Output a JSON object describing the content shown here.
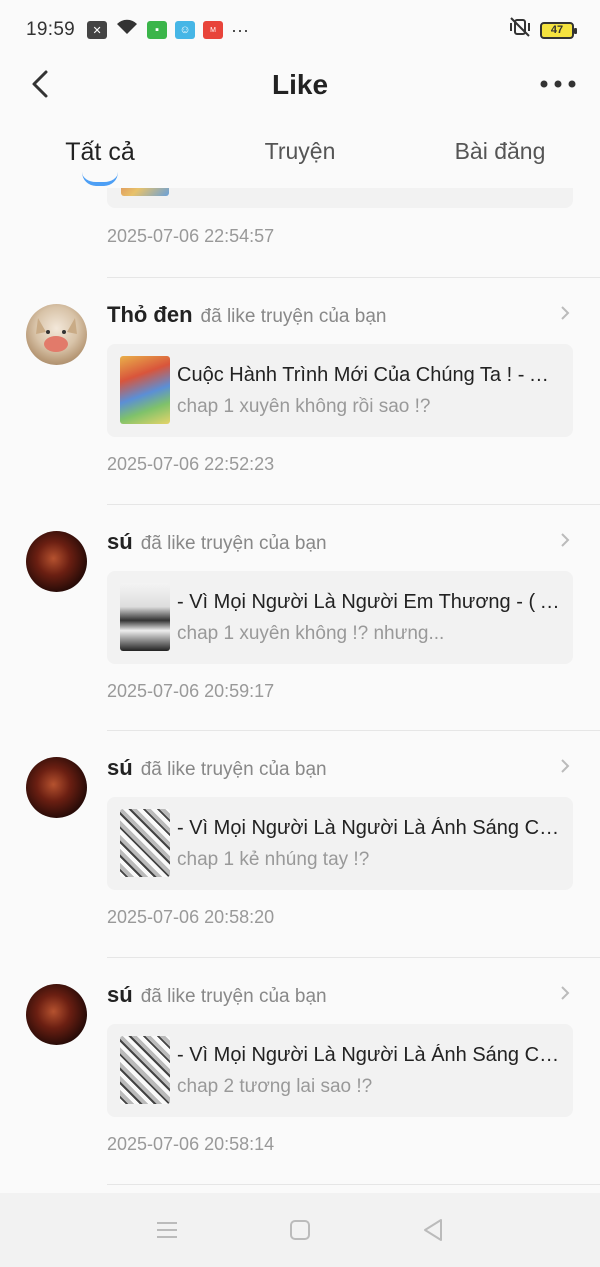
{
  "status_bar": {
    "time": "19:59",
    "more": "···",
    "battery": "47",
    "icons": [
      "close-box-icon",
      "wifi-icon",
      "app-green-icon",
      "app-blue-icon",
      "manga-app-icon",
      "mute-vibrate-icon"
    ]
  },
  "header": {
    "title": "Like"
  },
  "tabs": [
    {
      "label": "Tất cả",
      "active": true
    },
    {
      "label": "Truyện",
      "active": false
    },
    {
      "label": "Bài đăng",
      "active": false
    }
  ],
  "partial_item": {
    "time": "2025-07-06 22:54:57"
  },
  "items": [
    {
      "user": "Thỏ đen",
      "action": "đã like truyện của bạn",
      "title": "Cuộc Hành Trình Mới Của Chúng Ta ! - All ...",
      "subtitle": "chap 1 xuyên không rồi sao !?",
      "time": "2025-07-06 22:52:23"
    },
    {
      "user": "sú",
      "action": "đã like truyện của bạn",
      "title": "- Vì Mọi Người Là Người Em Thương - ( Al...",
      "subtitle": "chap 1 xuyên không !? nhưng...",
      "time": "2025-07-06 20:59:17"
    },
    {
      "user": "sú",
      "action": "đã like truyện của bạn",
      "title": "- Vì Mọi Người Là Người Là Ánh Sáng Của...",
      "subtitle": "chap 1 kẻ nhúng tay !?",
      "time": "2025-07-06 20:58:20"
    },
    {
      "user": "sú",
      "action": "đã like truyện của bạn",
      "title": "- Vì Mọi Người Là Người Là Ánh Sáng Của...",
      "subtitle": "chap 2 tương lai sao !?",
      "time": "2025-07-06 20:58:14"
    }
  ],
  "colors": {
    "accent": "#4d9ff5",
    "card_bg": "#f2f2f2",
    "muted_text": "#999999"
  }
}
